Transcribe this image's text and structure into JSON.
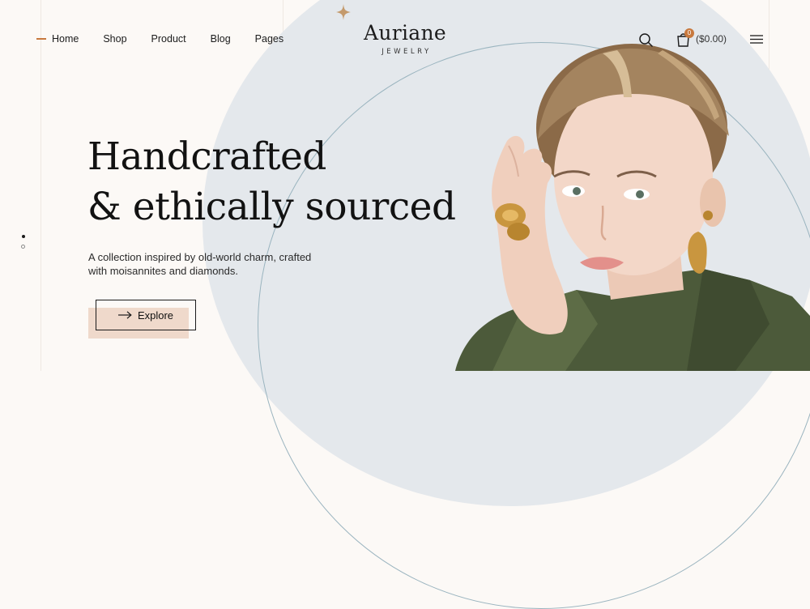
{
  "nav": {
    "items": [
      {
        "label": "Home"
      },
      {
        "label": "Shop"
      },
      {
        "label": "Product"
      },
      {
        "label": "Blog"
      },
      {
        "label": "Pages"
      }
    ],
    "active_accent": "#c8793e"
  },
  "brand": {
    "name": "Auriane",
    "tagline": "JEWELRY"
  },
  "header_actions": {
    "search_icon": "search-icon",
    "cart_icon": "shopping-bag-icon",
    "cart_count": "0",
    "cart_total": "($0.00)",
    "menu_icon": "hamburger-menu-icon"
  },
  "hero": {
    "headline_line1": "Handcrafted",
    "headline_line2": "& ethically sourced",
    "subtext_line1": "A collection inspired by old-world charm, crafted",
    "subtext_line2": "with moisannites and diamonds.",
    "cta_label": "Explore",
    "cta_icon": "arrow-right-icon"
  },
  "slider": {
    "active_index": 1,
    "total": 2
  },
  "colors": {
    "background": "#fcf9f6",
    "circle": "#e4e8ec",
    "accent": "#c8793e",
    "button_shadow": "#efd9cb",
    "text": "#1b1b1b"
  }
}
